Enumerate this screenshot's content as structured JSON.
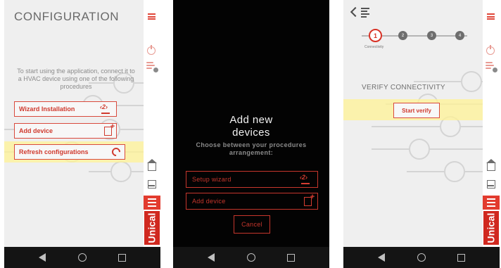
{
  "screen1": {
    "title": "CONFIGURATION",
    "intro": "To start using the application, connect it to a HVAC device using one of the following procedures",
    "buttons": [
      {
        "label": "Wizard Installation",
        "icon": "wizard-icon"
      },
      {
        "label": "Add device",
        "icon": "add-device-icon"
      },
      {
        "label": "Refresh configurations",
        "icon": "refresh-icon"
      }
    ],
    "highlight_color": "#fff396"
  },
  "screen2": {
    "title_line1": "Add new",
    "title_line2": "devices",
    "subtitle_line1": "Choose between your procedures",
    "subtitle_line2": "arrangement:",
    "options": [
      {
        "label": "Setup wizard",
        "icon": "wizard-icon"
      },
      {
        "label": "Add device",
        "icon": "add-device-icon"
      }
    ],
    "cancel_label": "Cancel"
  },
  "screen3": {
    "steps": [
      "1",
      "2",
      "3",
      "4"
    ],
    "active_step_label": "Connectivity",
    "section_title": "VERIFY CONNECTIVITY",
    "verify_button": "Start verify"
  },
  "rail": {
    "brand": "Unical",
    "icons": [
      "menu-icon",
      "power-icon",
      "fan-icon",
      "home-icon",
      "device-icon",
      "settings-icon"
    ],
    "accent_color": "#e23b2e"
  },
  "navbar": {
    "icons": [
      "back-icon",
      "home-circle-icon",
      "recent-apps-icon"
    ]
  }
}
